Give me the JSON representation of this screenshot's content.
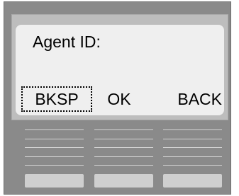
{
  "display": {
    "prompt": "Agent ID:",
    "softkeys": {
      "left": "BKSP",
      "middle": "OK",
      "right": "BACK"
    },
    "selected_softkey": "left"
  },
  "colors": {
    "device_body": "#8a8a8a",
    "bezel": "#bdbdbd",
    "screen": "#efefef",
    "keypad_lines": "#d4d4d4",
    "keypad_buttons": "#cfcfcf"
  }
}
